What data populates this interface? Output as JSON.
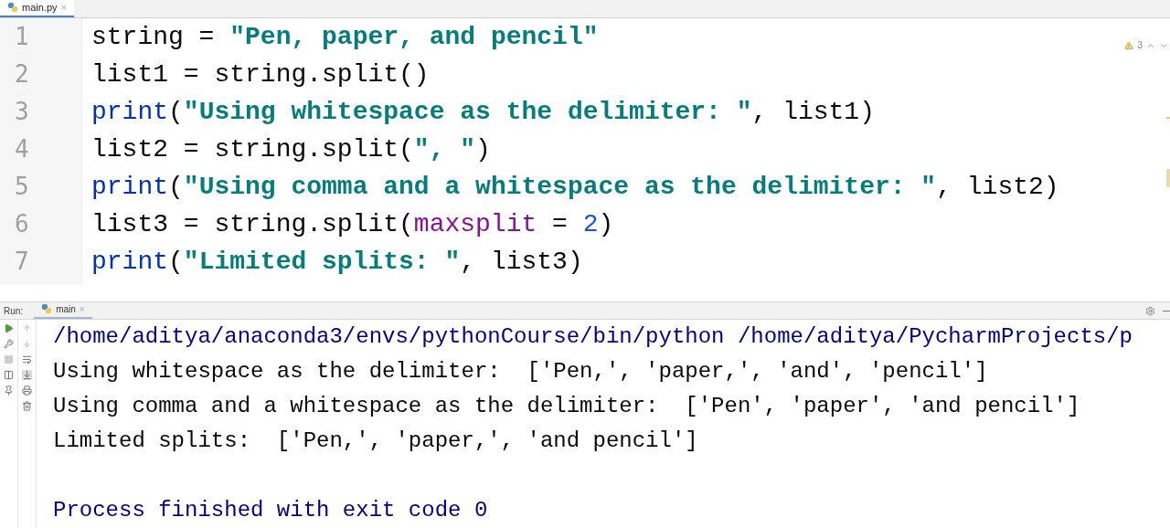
{
  "editor_tab": {
    "label": "main.py",
    "close": "×"
  },
  "inspection": {
    "warnings": "3"
  },
  "code_lines": [
    {
      "number": "1",
      "tokens": [
        {
          "kind": "plain",
          "text": "string = "
        },
        {
          "kind": "string",
          "text": "\"Pen, paper, and pencil\""
        }
      ]
    },
    {
      "number": "2",
      "tokens": [
        {
          "kind": "plain",
          "text": "list1 = string.split()"
        }
      ]
    },
    {
      "number": "3",
      "tokens": [
        {
          "kind": "builtin",
          "text": "print"
        },
        {
          "kind": "plain",
          "text": "("
        },
        {
          "kind": "string",
          "text": "\"Using whitespace as the delimiter: \""
        },
        {
          "kind": "plain",
          "text": ", list1)"
        }
      ]
    },
    {
      "number": "4",
      "tokens": [
        {
          "kind": "plain",
          "text": "list2 = string.split("
        },
        {
          "kind": "string",
          "text": "\", \""
        },
        {
          "kind": "plain",
          "text": ")"
        }
      ]
    },
    {
      "number": "5",
      "tokens": [
        {
          "kind": "builtin",
          "text": "print"
        },
        {
          "kind": "plain",
          "text": "("
        },
        {
          "kind": "string",
          "text": "\"Using comma and a whitespace as the delimiter: \""
        },
        {
          "kind": "plain",
          "text": ", list2)"
        }
      ]
    },
    {
      "number": "6",
      "tokens": [
        {
          "kind": "plain",
          "text": "list3 = string.split("
        },
        {
          "kind": "param",
          "text": "maxsplit"
        },
        {
          "kind": "plain",
          "text": " = "
        },
        {
          "kind": "number",
          "text": "2"
        },
        {
          "kind": "plain",
          "text": ")"
        }
      ]
    },
    {
      "number": "7",
      "tokens": [
        {
          "kind": "builtin",
          "text": "print"
        },
        {
          "kind": "plain",
          "text": "("
        },
        {
          "kind": "string",
          "text": "\"Limited splits: \""
        },
        {
          "kind": "plain",
          "text": ", list3)"
        }
      ]
    }
  ],
  "run_panel": {
    "label": "Run:",
    "tab": {
      "label": "main",
      "close": "×",
      "selected": true
    }
  },
  "console_lines": [
    {
      "kind": "command",
      "text": "/home/aditya/anaconda3/envs/pythonCourse/bin/python /home/aditya/PycharmProjects/p"
    },
    {
      "kind": "output",
      "text": "Using whitespace as the delimiter:  ['Pen,', 'paper,', 'and', 'pencil']"
    },
    {
      "kind": "output",
      "text": "Using comma and a whitespace as the delimiter:  ['Pen', 'paper', 'and pencil']"
    },
    {
      "kind": "output",
      "text": "Limited splits:  ['Pen,', 'paper,', 'and pencil']"
    },
    {
      "kind": "blank"
    },
    {
      "kind": "system",
      "text": "Process finished with exit code 0"
    }
  ]
}
